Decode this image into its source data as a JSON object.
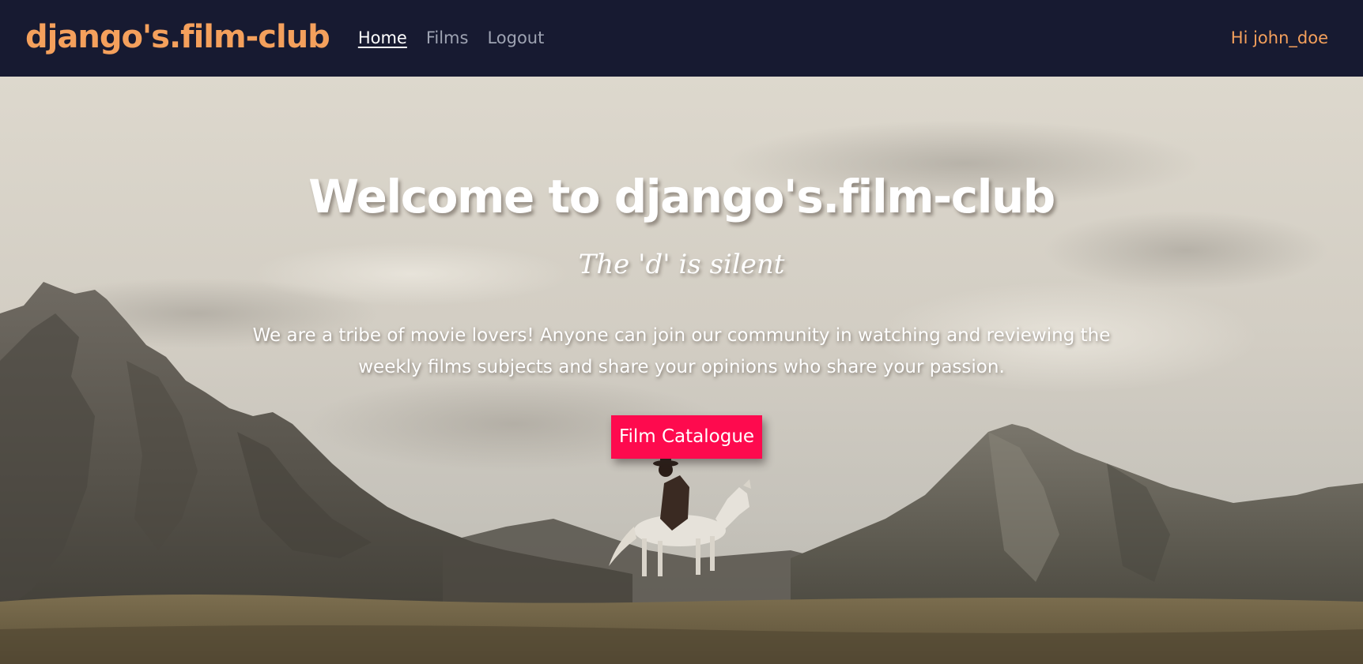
{
  "navbar": {
    "brand": "django's.film-club",
    "links": [
      {
        "label": "Home",
        "active": true
      },
      {
        "label": "Films",
        "active": false
      },
      {
        "label": "Logout",
        "active": false
      }
    ],
    "greeting": "Hi john_doe"
  },
  "hero": {
    "title": "Welcome to django's.film-club",
    "subtitle": "The 'd' is silent",
    "description": "We are a tribe of movie lovers! Anyone can join our community in watching and reviewing the weekly films subjects and share your opinions who share your passion.",
    "cta_label": "Film Catalogue"
  },
  "colors": {
    "navbar_bg": "#171a31",
    "brand": "#f4a05c",
    "nav_inactive": "#9ea3b2",
    "cta_bg": "#fe0a4e"
  }
}
